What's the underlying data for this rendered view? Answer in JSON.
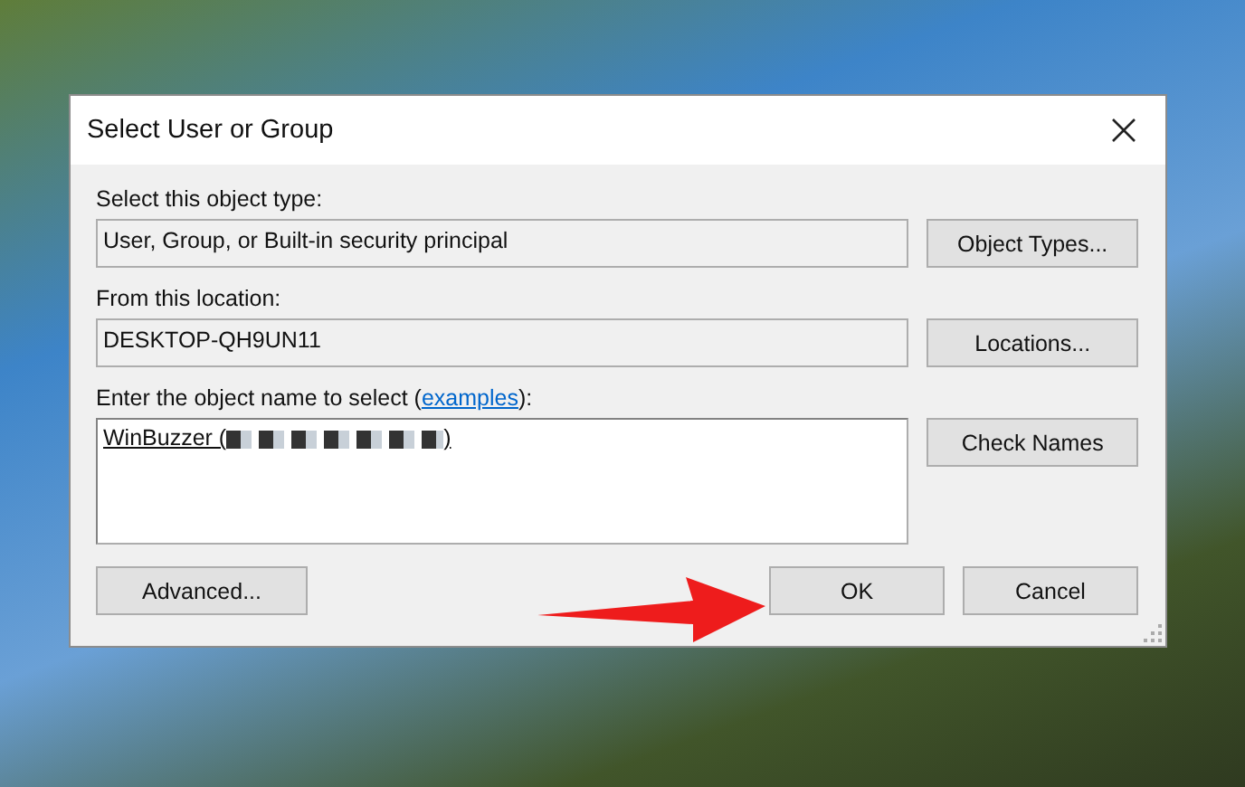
{
  "window": {
    "title": "Select User or Group"
  },
  "object_type": {
    "label": "Select this object type:",
    "value": "User, Group, or Built-in security principal",
    "button": "Object Types..."
  },
  "location": {
    "label": "From this location:",
    "value": "DESKTOP-QH9UN11",
    "button": "Locations..."
  },
  "object_name": {
    "label_before": "Enter the object name to select (",
    "link": "examples",
    "label_after": "):",
    "value_prefix": "WinBuzzer (",
    "value_suffix": ")",
    "button": "Check Names"
  },
  "buttons": [
    {
      "label": "Advanced...",
      "kind": "left"
    },
    {
      "label": "OK",
      "kind": "right"
    },
    {
      "label": "Cancel",
      "kind": "right"
    }
  ]
}
